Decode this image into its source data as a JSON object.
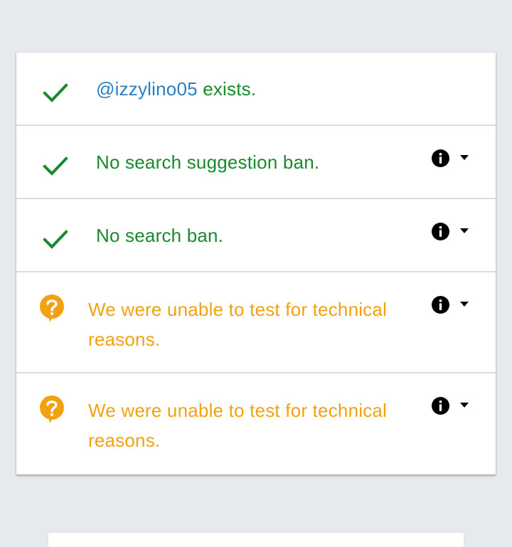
{
  "results": [
    {
      "status": "ok",
      "icon": "checkmark-icon",
      "parts": [
        {
          "text": "@izzylino05",
          "role": "username-link"
        },
        {
          "text": " exists.",
          "role": "text"
        }
      ],
      "has_actions": false
    },
    {
      "status": "ok",
      "icon": "checkmark-icon",
      "text": "No search suggestion ban.",
      "has_actions": true
    },
    {
      "status": "ok",
      "icon": "checkmark-icon",
      "text": "No search ban.",
      "has_actions": true
    },
    {
      "status": "unknown",
      "icon": "question-bubble-icon",
      "text": "We were unable to test for technical reasons.",
      "has_actions": true
    },
    {
      "status": "unknown",
      "icon": "question-bubble-icon",
      "text": "We were unable to test for technical reasons.",
      "has_actions": true
    }
  ],
  "colors": {
    "ok": "#188a2c",
    "link": "#2a7fc0",
    "unknown": "#f2a211",
    "background": "#e6eaee"
  },
  "icons": {
    "info": "info-icon",
    "expand": "caret-down-icon"
  }
}
